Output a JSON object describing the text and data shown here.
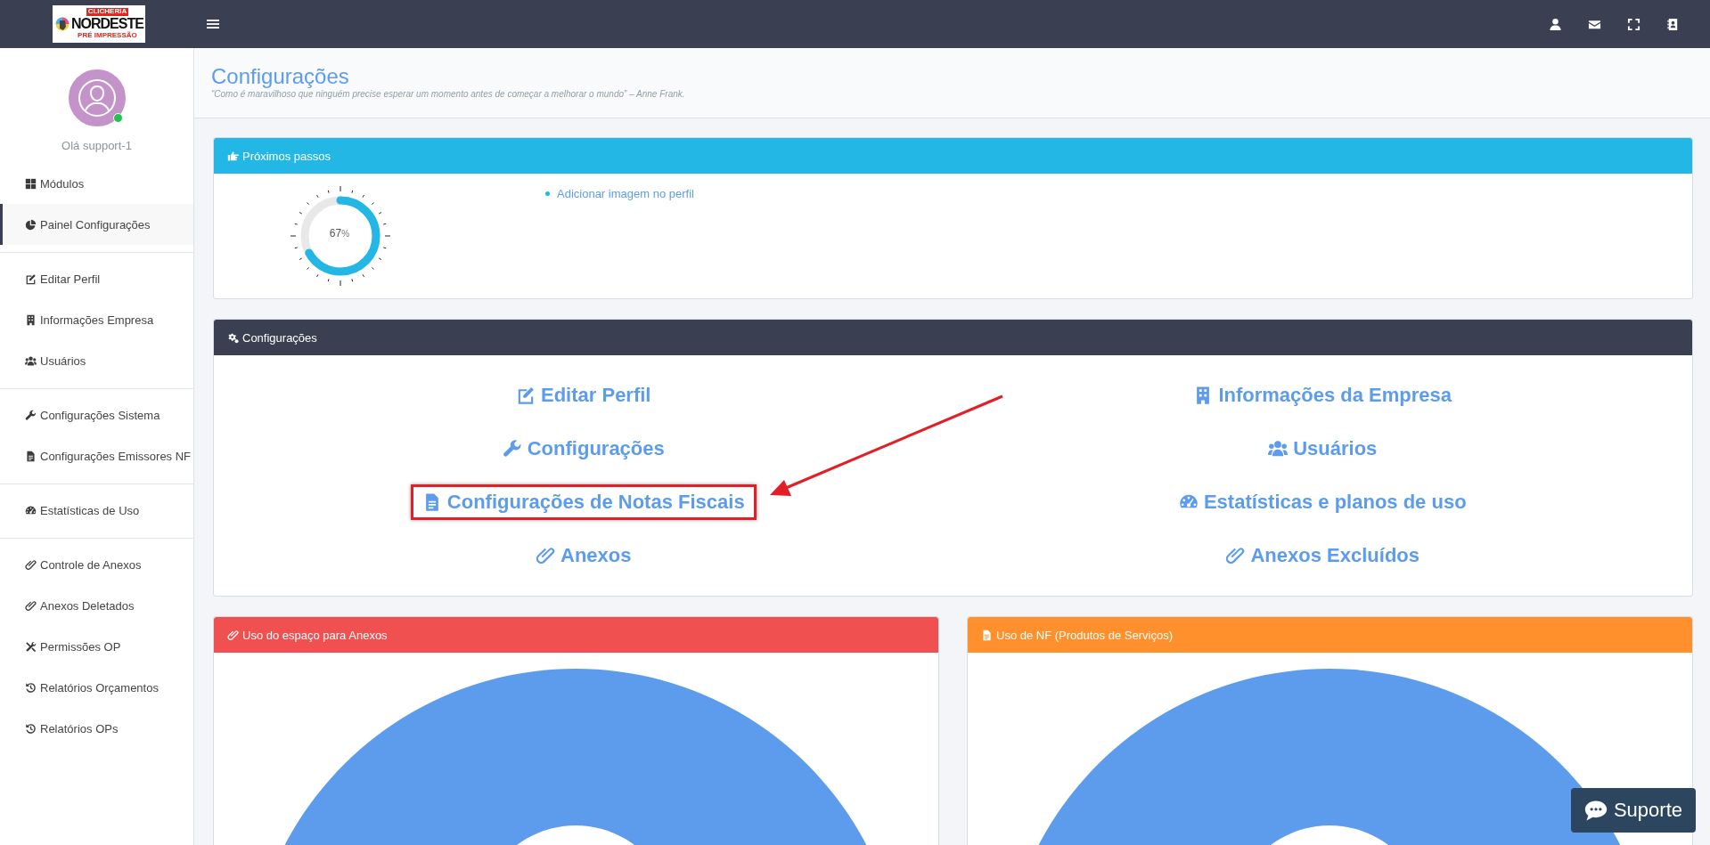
{
  "topbar": {
    "logo": {
      "top": "CLICHERIA",
      "main": "NORDESTE",
      "sub": "PRÉ IMPRESSÃO"
    }
  },
  "sidebar": {
    "greeting": "Olá support-1",
    "online": true,
    "groups": [
      [
        {
          "label": "Módulos",
          "selected": false
        },
        {
          "label": "Painel Configurações",
          "selected": true
        }
      ],
      [
        {
          "label": "Editar Perfil",
          "selected": false
        },
        {
          "label": "Informações Empresa",
          "selected": false
        },
        {
          "label": "Usuários",
          "selected": false
        }
      ],
      [
        {
          "label": "Configurações Sistema",
          "selected": false
        },
        {
          "label": "Configurações Emissores NF",
          "selected": false
        }
      ],
      [
        {
          "label": "Estatísticas de Uso",
          "selected": false
        }
      ],
      [
        {
          "label": "Controle de Anexos",
          "selected": false
        },
        {
          "label": "Anexos Deletados",
          "selected": false
        },
        {
          "label": "Permissões OP",
          "selected": false
        },
        {
          "label": "Relatórios Orçamentos",
          "selected": false
        },
        {
          "label": "Relatórios OPs",
          "selected": false
        }
      ]
    ]
  },
  "page": {
    "title": "Configurações",
    "quote": "“Como é maravilhoso que ninguém precise esperar um momento antes de começar a melhorar o mundo” – Anne Frank."
  },
  "next_steps": {
    "title": "Próximos passos",
    "progress": {
      "level": 0.67,
      "value": "67",
      "unit": "%"
    },
    "items": [
      "Adicionar imagem no perfil"
    ]
  },
  "settings": {
    "title": "Configurações",
    "links": [
      {
        "label": "Editar Perfil",
        "highlighted": false
      },
      {
        "label": "Informações da Empresa",
        "highlighted": false
      },
      {
        "label": "Configurações",
        "highlighted": false
      },
      {
        "label": "Usuários",
        "highlighted": false
      },
      {
        "label": "Configurações de Notas Fiscais",
        "highlighted": true
      },
      {
        "label": "Estatísticas e planos de uso",
        "highlighted": false
      },
      {
        "label": "Anexos",
        "highlighted": false
      },
      {
        "label": "Anexos Excluídos",
        "highlighted": false
      }
    ]
  },
  "charts": [
    {
      "title": "Uso do espaço para Anexos",
      "color": "#f05050"
    },
    {
      "title": "Uso de NF (Produtos de Serviços)",
      "color": "#ff902b"
    }
  ],
  "support_button": {
    "label": "Suporte"
  }
}
